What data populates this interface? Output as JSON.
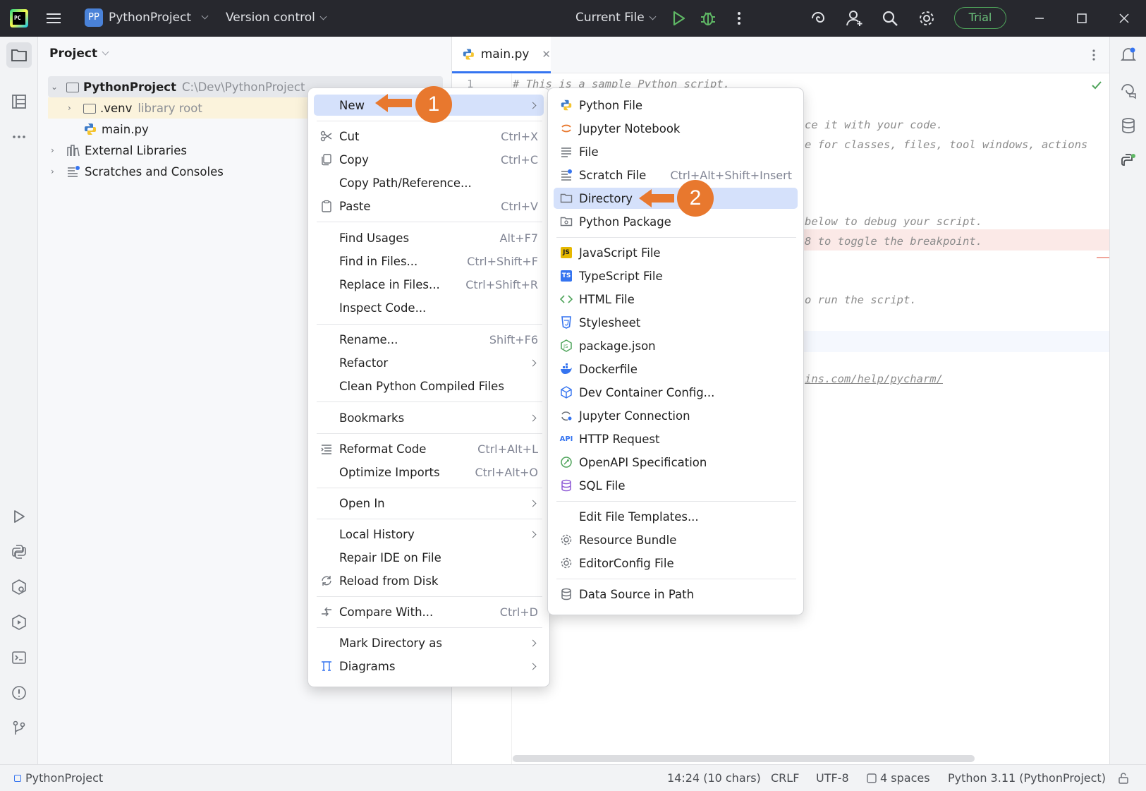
{
  "titlebar": {
    "project_badge": "PP",
    "project_name": "PythonProject",
    "version_control": "Version control",
    "run_config": "Current File",
    "trial": "Trial"
  },
  "project_panel": {
    "title": "Project",
    "tree": [
      {
        "label": "PythonProject",
        "hint": "C:\\Dev\\PythonProject"
      },
      {
        "label": ".venv",
        "hint": "library root"
      },
      {
        "label": "main.py",
        "hint": ""
      },
      {
        "label": "External Libraries",
        "hint": ""
      },
      {
        "label": "Scratches and Consoles",
        "hint": ""
      }
    ]
  },
  "editor": {
    "tab": "main.py",
    "line_number": "1",
    "lines": [
      "# This is a sample Python script.",
      "ce it with your code.",
      "e for classes, files, tool windows, actions",
      "below to debug your script.",
      "8 to toggle the breakpoint.",
      "o run the script.",
      "ins.com/help/pycharm/"
    ]
  },
  "context_menu": {
    "items": [
      {
        "label": "New",
        "shortcut": "",
        "submenu": true
      },
      {
        "label": "Cut",
        "shortcut": "Ctrl+X"
      },
      {
        "label": "Copy",
        "shortcut": "Ctrl+C"
      },
      {
        "label": "Copy Path/Reference...",
        "shortcut": ""
      },
      {
        "label": "Paste",
        "shortcut": "Ctrl+V"
      },
      {
        "label": "Find Usages",
        "shortcut": "Alt+F7"
      },
      {
        "label": "Find in Files...",
        "shortcut": "Ctrl+Shift+F"
      },
      {
        "label": "Replace in Files...",
        "shortcut": "Ctrl+Shift+R"
      },
      {
        "label": "Inspect Code...",
        "shortcut": ""
      },
      {
        "label": "Rename...",
        "shortcut": "Shift+F6"
      },
      {
        "label": "Refactor",
        "shortcut": "",
        "submenu": true
      },
      {
        "label": "Clean Python Compiled Files",
        "shortcut": ""
      },
      {
        "label": "Bookmarks",
        "shortcut": "",
        "submenu": true
      },
      {
        "label": "Reformat Code",
        "shortcut": "Ctrl+Alt+L"
      },
      {
        "label": "Optimize Imports",
        "shortcut": "Ctrl+Alt+O"
      },
      {
        "label": "Open In",
        "shortcut": "",
        "submenu": true
      },
      {
        "label": "Local History",
        "shortcut": "",
        "submenu": true
      },
      {
        "label": "Repair IDE on File",
        "shortcut": ""
      },
      {
        "label": "Reload from Disk",
        "shortcut": ""
      },
      {
        "label": "Compare With...",
        "shortcut": "Ctrl+D"
      },
      {
        "label": "Mark Directory as",
        "shortcut": "",
        "submenu": true
      },
      {
        "label": "Diagrams",
        "shortcut": "",
        "submenu": true
      }
    ]
  },
  "new_submenu": {
    "items": [
      {
        "label": "Python File",
        "shortcut": ""
      },
      {
        "label": "Jupyter Notebook",
        "shortcut": ""
      },
      {
        "label": "File",
        "shortcut": ""
      },
      {
        "label": "Scratch File",
        "shortcut": "Ctrl+Alt+Shift+Insert"
      },
      {
        "label": "Directory",
        "shortcut": ""
      },
      {
        "label": "Python Package",
        "shortcut": ""
      },
      {
        "label": "JavaScript File",
        "shortcut": ""
      },
      {
        "label": "TypeScript File",
        "shortcut": ""
      },
      {
        "label": "HTML File",
        "shortcut": ""
      },
      {
        "label": "Stylesheet",
        "shortcut": ""
      },
      {
        "label": "package.json",
        "shortcut": ""
      },
      {
        "label": "Dockerfile",
        "shortcut": ""
      },
      {
        "label": "Dev Container Config...",
        "shortcut": ""
      },
      {
        "label": "Jupyter Connection",
        "shortcut": ""
      },
      {
        "label": "HTTP Request",
        "shortcut": ""
      },
      {
        "label": "OpenAPI Specification",
        "shortcut": ""
      },
      {
        "label": "SQL File",
        "shortcut": ""
      },
      {
        "label": "Edit File Templates...",
        "shortcut": ""
      },
      {
        "label": "Resource Bundle",
        "shortcut": ""
      },
      {
        "label": "EditorConfig File",
        "shortcut": ""
      },
      {
        "label": "Data Source in Path",
        "shortcut": ""
      }
    ]
  },
  "callouts": {
    "first": "1",
    "second": "2"
  },
  "statusbar": {
    "breadcrumb": "PythonProject",
    "position": "14:24 (10 chars)",
    "line_sep": "CRLF",
    "encoding": "UTF-8",
    "indent": "4 spaces",
    "interpreter": "Python 3.11 (PythonProject)"
  },
  "colors": {
    "accent": "#3574f0",
    "highlight": "#d5e1fb",
    "callout": "#e8782e",
    "titlebar": "#27282e"
  }
}
